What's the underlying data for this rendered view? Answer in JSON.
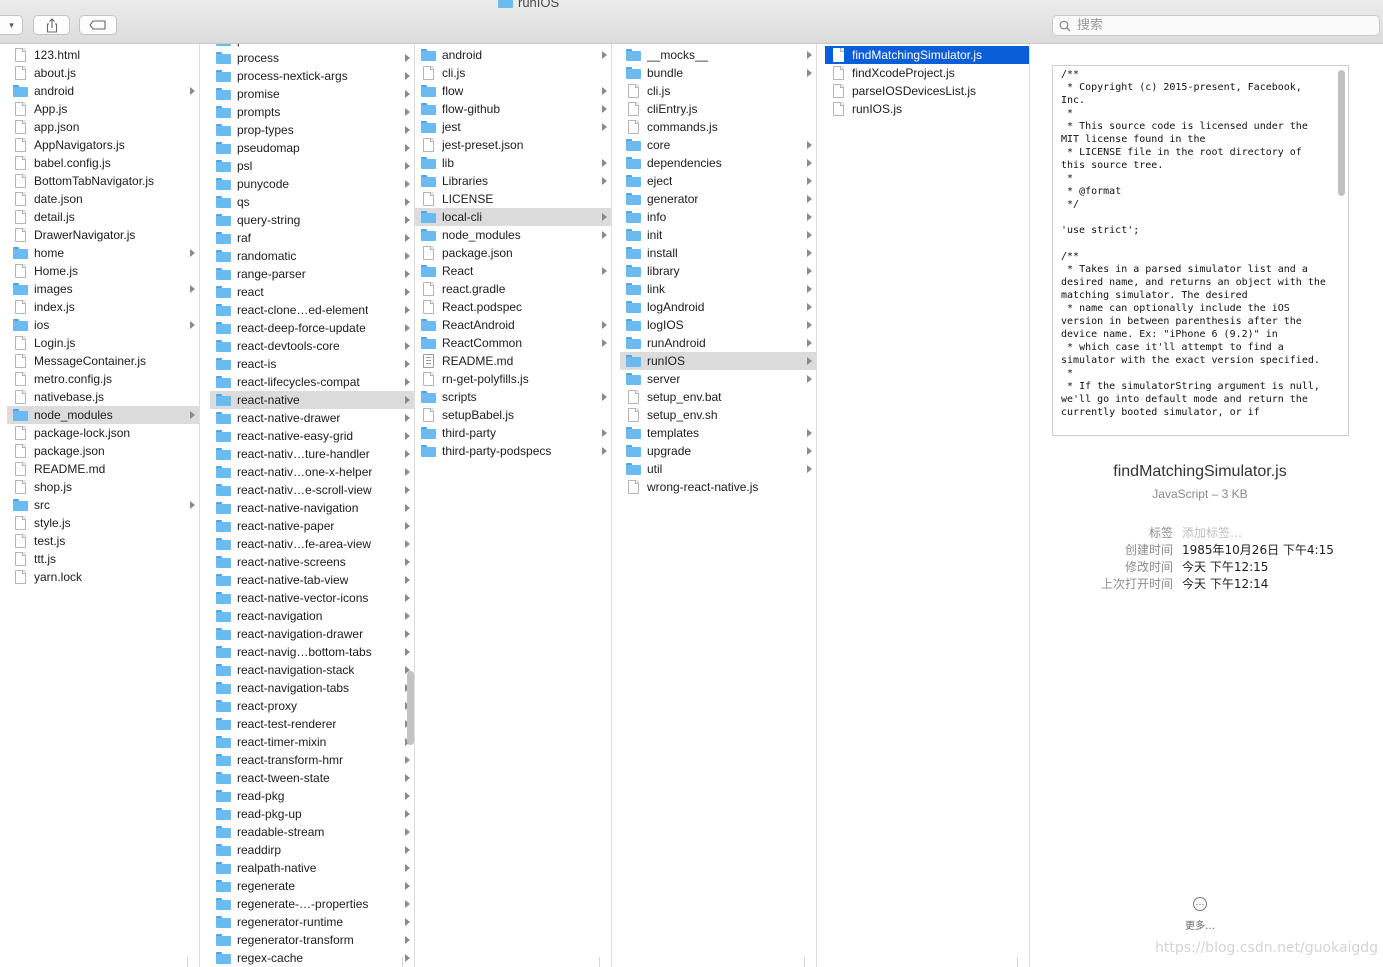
{
  "window": {
    "title": "runIOS"
  },
  "toolbar": {
    "share_label": "",
    "tag_label": ""
  },
  "search": {
    "placeholder": "搜索"
  },
  "columns": [
    {
      "name": "column-1",
      "items": [
        {
          "name": "123.html",
          "type": "file"
        },
        {
          "name": "about.js",
          "type": "file"
        },
        {
          "name": "android",
          "type": "folder"
        },
        {
          "name": "App.js",
          "type": "file"
        },
        {
          "name": "app.json",
          "type": "file"
        },
        {
          "name": "AppNavigators.js",
          "type": "file"
        },
        {
          "name": "babel.config.js",
          "type": "file"
        },
        {
          "name": "BottomTabNavigator.js",
          "type": "file"
        },
        {
          "name": "date.json",
          "type": "file"
        },
        {
          "name": "detail.js",
          "type": "file"
        },
        {
          "name": "DrawerNavigator.js",
          "type": "file"
        },
        {
          "name": "home",
          "type": "folder"
        },
        {
          "name": "Home.js",
          "type": "file"
        },
        {
          "name": "images",
          "type": "folder"
        },
        {
          "name": "index.js",
          "type": "file"
        },
        {
          "name": "ios",
          "type": "folder"
        },
        {
          "name": "Login.js",
          "type": "file"
        },
        {
          "name": "MessageContainer.js",
          "type": "file"
        },
        {
          "name": "metro.config.js",
          "type": "file"
        },
        {
          "name": "nativebase.js",
          "type": "file"
        },
        {
          "name": "node_modules",
          "type": "folder",
          "selected": "gray"
        },
        {
          "name": "package-lock.json",
          "type": "file"
        },
        {
          "name": "package.json",
          "type": "file"
        },
        {
          "name": "README.md",
          "type": "file"
        },
        {
          "name": "shop.js",
          "type": "file"
        },
        {
          "name": "src",
          "type": "folder"
        },
        {
          "name": "style.js",
          "type": "file"
        },
        {
          "name": "test.js",
          "type": "file"
        },
        {
          "name": "ttt.js",
          "type": "file"
        },
        {
          "name": "yarn.lock",
          "type": "file"
        }
      ]
    },
    {
      "name": "column-2",
      "items": [
        {
          "name": "private",
          "type": "folder"
        },
        {
          "name": "process",
          "type": "folder"
        },
        {
          "name": "process-nextick-args",
          "type": "folder"
        },
        {
          "name": "promise",
          "type": "folder"
        },
        {
          "name": "prompts",
          "type": "folder"
        },
        {
          "name": "prop-types",
          "type": "folder"
        },
        {
          "name": "pseudomap",
          "type": "folder"
        },
        {
          "name": "psl",
          "type": "folder"
        },
        {
          "name": "punycode",
          "type": "folder"
        },
        {
          "name": "qs",
          "type": "folder"
        },
        {
          "name": "query-string",
          "type": "folder"
        },
        {
          "name": "raf",
          "type": "folder"
        },
        {
          "name": "randomatic",
          "type": "folder"
        },
        {
          "name": "range-parser",
          "type": "folder"
        },
        {
          "name": "react",
          "type": "folder"
        },
        {
          "name": "react-clone…ed-element",
          "type": "folder"
        },
        {
          "name": "react-deep-force-update",
          "type": "folder"
        },
        {
          "name": "react-devtools-core",
          "type": "folder"
        },
        {
          "name": "react-is",
          "type": "folder"
        },
        {
          "name": "react-lifecycles-compat",
          "type": "folder"
        },
        {
          "name": "react-native",
          "type": "folder",
          "selected": "gray"
        },
        {
          "name": "react-native-drawer",
          "type": "folder"
        },
        {
          "name": "react-native-easy-grid",
          "type": "folder"
        },
        {
          "name": "react-nativ…ture-handler",
          "type": "folder"
        },
        {
          "name": "react-nativ…one-x-helper",
          "type": "folder"
        },
        {
          "name": "react-nativ…e-scroll-view",
          "type": "folder"
        },
        {
          "name": "react-native-navigation",
          "type": "folder"
        },
        {
          "name": "react-native-paper",
          "type": "folder"
        },
        {
          "name": "react-nativ…fe-area-view",
          "type": "folder"
        },
        {
          "name": "react-native-screens",
          "type": "folder"
        },
        {
          "name": "react-native-tab-view",
          "type": "folder"
        },
        {
          "name": "react-native-vector-icons",
          "type": "folder"
        },
        {
          "name": "react-navigation",
          "type": "folder"
        },
        {
          "name": "react-navigation-drawer",
          "type": "folder"
        },
        {
          "name": "react-navig…bottom-tabs",
          "type": "folder"
        },
        {
          "name": "react-navigation-stack",
          "type": "folder"
        },
        {
          "name": "react-navigation-tabs",
          "type": "folder"
        },
        {
          "name": "react-proxy",
          "type": "folder"
        },
        {
          "name": "react-test-renderer",
          "type": "folder"
        },
        {
          "name": "react-timer-mixin",
          "type": "folder"
        },
        {
          "name": "react-transform-hmr",
          "type": "folder"
        },
        {
          "name": "react-tween-state",
          "type": "folder"
        },
        {
          "name": "read-pkg",
          "type": "folder"
        },
        {
          "name": "read-pkg-up",
          "type": "folder"
        },
        {
          "name": "readable-stream",
          "type": "folder"
        },
        {
          "name": "readdirp",
          "type": "folder"
        },
        {
          "name": "realpath-native",
          "type": "folder"
        },
        {
          "name": "regenerate",
          "type": "folder"
        },
        {
          "name": "regenerate-…-properties",
          "type": "folder"
        },
        {
          "name": "regenerator-runtime",
          "type": "folder"
        },
        {
          "name": "regenerator-transform",
          "type": "folder"
        },
        {
          "name": "regex-cache",
          "type": "folder"
        }
      ]
    },
    {
      "name": "column-3",
      "items": [
        {
          "name": "android",
          "type": "folder"
        },
        {
          "name": "cli.js",
          "type": "file"
        },
        {
          "name": "flow",
          "type": "folder"
        },
        {
          "name": "flow-github",
          "type": "folder"
        },
        {
          "name": "jest",
          "type": "folder"
        },
        {
          "name": "jest-preset.json",
          "type": "file"
        },
        {
          "name": "lib",
          "type": "folder"
        },
        {
          "name": "Libraries",
          "type": "folder"
        },
        {
          "name": "LICENSE",
          "type": "file"
        },
        {
          "name": "local-cli",
          "type": "folder",
          "selected": "gray"
        },
        {
          "name": "node_modules",
          "type": "folder"
        },
        {
          "name": "package.json",
          "type": "file"
        },
        {
          "name": "React",
          "type": "folder"
        },
        {
          "name": "react.gradle",
          "type": "file"
        },
        {
          "name": "React.podspec",
          "type": "file"
        },
        {
          "name": "ReactAndroid",
          "type": "folder"
        },
        {
          "name": "ReactCommon",
          "type": "folder"
        },
        {
          "name": "README.md",
          "type": "lines"
        },
        {
          "name": "rn-get-polyfills.js",
          "type": "file"
        },
        {
          "name": "scripts",
          "type": "folder"
        },
        {
          "name": "setupBabel.js",
          "type": "file"
        },
        {
          "name": "third-party",
          "type": "folder"
        },
        {
          "name": "third-party-podspecs",
          "type": "folder"
        }
      ]
    },
    {
      "name": "column-4",
      "items": [
        {
          "name": "__mocks__",
          "type": "folder"
        },
        {
          "name": "bundle",
          "type": "folder"
        },
        {
          "name": "cli.js",
          "type": "file"
        },
        {
          "name": "cliEntry.js",
          "type": "file"
        },
        {
          "name": "commands.js",
          "type": "file"
        },
        {
          "name": "core",
          "type": "folder"
        },
        {
          "name": "dependencies",
          "type": "folder"
        },
        {
          "name": "eject",
          "type": "folder"
        },
        {
          "name": "generator",
          "type": "folder"
        },
        {
          "name": "info",
          "type": "folder"
        },
        {
          "name": "init",
          "type": "folder"
        },
        {
          "name": "install",
          "type": "folder"
        },
        {
          "name": "library",
          "type": "folder"
        },
        {
          "name": "link",
          "type": "folder"
        },
        {
          "name": "logAndroid",
          "type": "folder"
        },
        {
          "name": "logIOS",
          "type": "folder"
        },
        {
          "name": "runAndroid",
          "type": "folder"
        },
        {
          "name": "runIOS",
          "type": "folder",
          "selected": "gray"
        },
        {
          "name": "server",
          "type": "folder"
        },
        {
          "name": "setup_env.bat",
          "type": "file"
        },
        {
          "name": "setup_env.sh",
          "type": "file"
        },
        {
          "name": "templates",
          "type": "folder"
        },
        {
          "name": "upgrade",
          "type": "folder"
        },
        {
          "name": "util",
          "type": "folder"
        },
        {
          "name": "wrong-react-native.js",
          "type": "file"
        }
      ]
    },
    {
      "name": "column-5",
      "items": [
        {
          "name": "findMatchingSimulator.js",
          "type": "file",
          "selected": "blue"
        },
        {
          "name": "findXcodeProject.js",
          "type": "file"
        },
        {
          "name": "parseIOSDevicesList.js",
          "type": "file"
        },
        {
          "name": "runIOS.js",
          "type": "file"
        }
      ]
    }
  ],
  "preview": {
    "code": "/**\n * Copyright (c) 2015-present, Facebook, Inc.\n *\n * This source code is licensed under the MIT license found in the\n * LICENSE file in the root directory of this source tree.\n *\n * @format\n */\n\n'use strict';\n\n/**\n * Takes in a parsed simulator list and a desired name, and returns an object with the matching simulator. The desired\n * name can optionally include the iOS version in between parenthesis after the device name. Ex: \"iPhone 6 (9.2)\" in\n * which case it'll attempt to find a simulator with the exact version specified.\n *\n * If the simulatorString argument is null, we'll go into default mode and return the currently booted simulator, or if",
    "file_name": "findMatchingSimulator.js",
    "kind": "JavaScript – 3 KB",
    "meta": [
      {
        "key": "标签",
        "value": "添加标签…",
        "placeholder": true
      },
      {
        "key": "创建时间",
        "value": "1985年10月26日 下午4:15"
      },
      {
        "key": "修改时间",
        "value": "今天 下午12:15"
      },
      {
        "key": "上次打开时间",
        "value": "今天 下午12:14"
      }
    ],
    "more_label": "更多…"
  },
  "watermark": "https://blog.csdn.net/guokaigdg",
  "colors": {
    "selection_blue": "#0a5fd8",
    "selection_gray": "#dcdcdc",
    "folder": "#69bbf2"
  }
}
